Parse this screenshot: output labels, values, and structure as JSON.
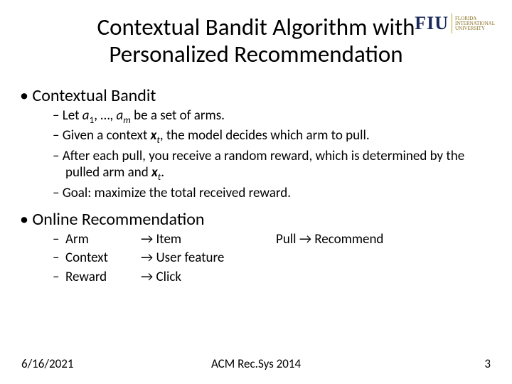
{
  "logo": {
    "abbr": "FIU",
    "line1": "FLORIDA",
    "line2": "INTERNATIONAL",
    "line3": "UNIVERSITY"
  },
  "title": "Contextual Bandit Algorithm with Personalized Recommendation",
  "section1": {
    "heading": "Contextual Bandit",
    "items": {
      "b1_pre": "Let ",
      "b1_a1": "a",
      "b1_s1": "1",
      "b1_mid": ", …, ",
      "b1_a2": "a",
      "b1_s2": "m",
      "b1_post": " be a set of arms.",
      "b2_pre": "Given a context ",
      "b2_x": "x",
      "b2_t": "t",
      "b2_post": ", the model decides which arm to pull.",
      "b3_pre": "After each pull, you receive a random reward, which is determined by the pulled arm and ",
      "b3_x": "x",
      "b3_t": "t",
      "b3_post": ".",
      "b4": "Goal: maximize the total received reward."
    }
  },
  "section2": {
    "heading": "Online Recommendation",
    "rows": [
      {
        "a": "Arm",
        "b": "→ Item",
        "c": "Pull → Recommend"
      },
      {
        "a": "Context",
        "b": "→ User feature",
        "c": ""
      },
      {
        "a": "Reward",
        "b": "→ Click",
        "c": ""
      }
    ]
  },
  "footer": {
    "date": "6/16/2021",
    "venue": "ACM Rec.Sys 2014",
    "page": "3"
  }
}
